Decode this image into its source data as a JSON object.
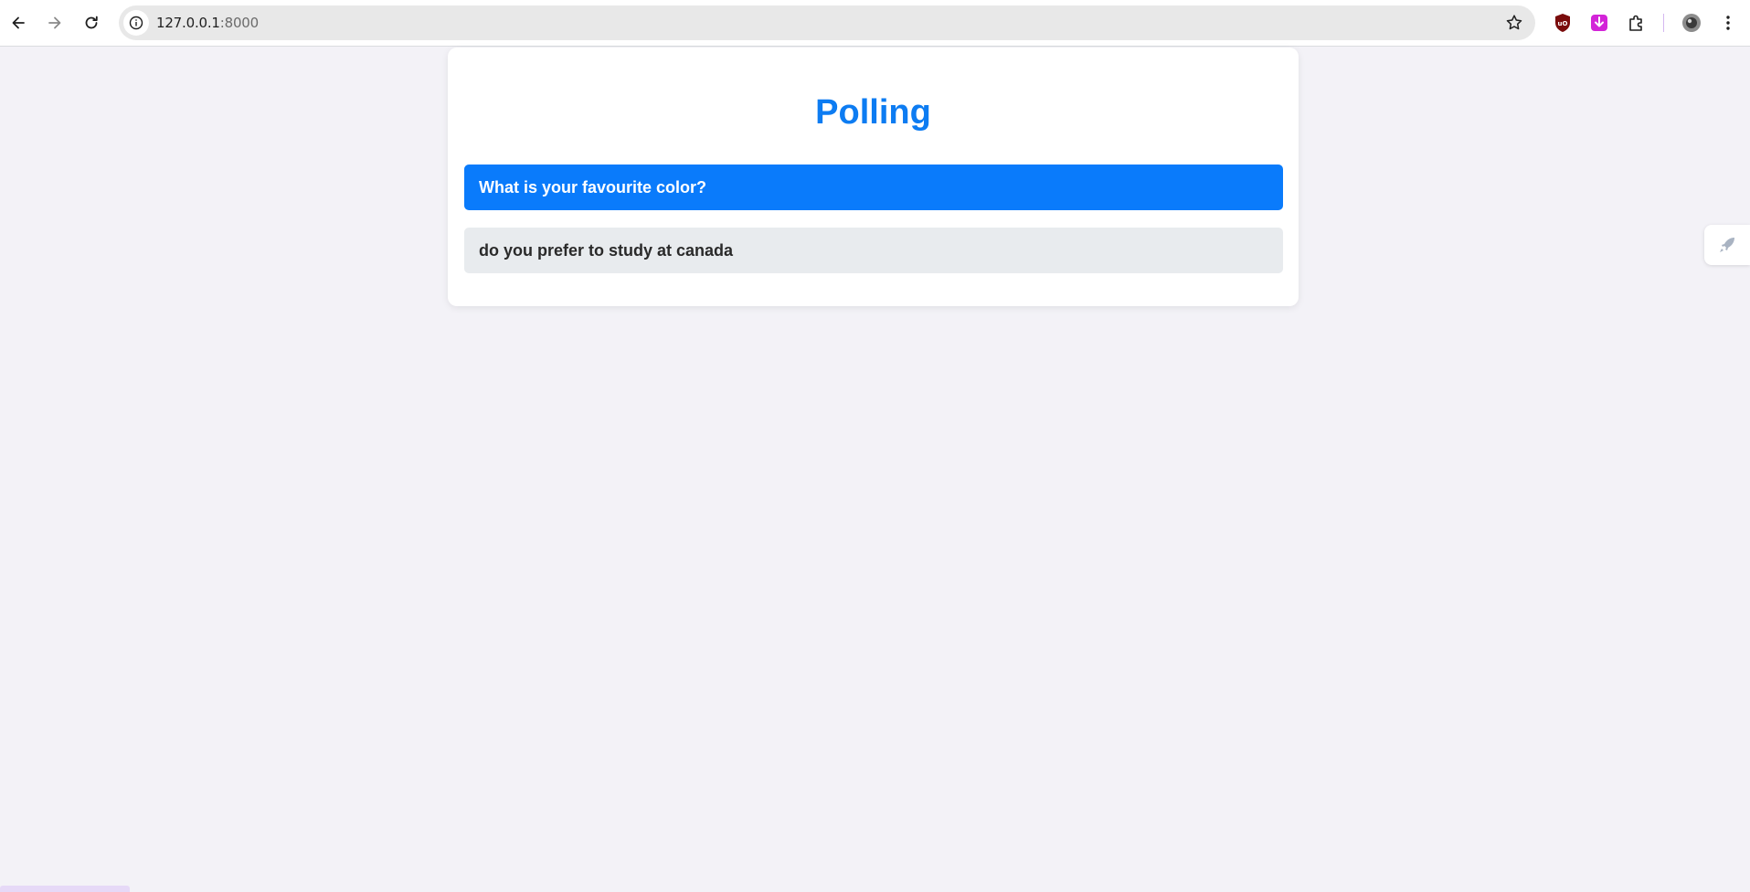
{
  "browser": {
    "url_host": "127.0.0.1",
    "url_port": ":8000",
    "icons": [
      "back-icon",
      "forward-icon",
      "reload-icon",
      "info-icon",
      "bookmark-star-icon",
      "ublock-extension-icon",
      "download-extension-icon",
      "extensions-puzzle-icon",
      "profile-avatar",
      "menu-kebab-icon"
    ]
  },
  "page": {
    "title": "Polling",
    "polls": [
      {
        "label": "What is your favourite color?",
        "state": "active"
      },
      {
        "label": "do you prefer to study at canada",
        "state": "normal"
      }
    ]
  },
  "colors": {
    "accent": "#0a7bfb",
    "title": "#0d7cf2",
    "background": "#f3f2f7",
    "item_inactive": "#e8ebee"
  }
}
